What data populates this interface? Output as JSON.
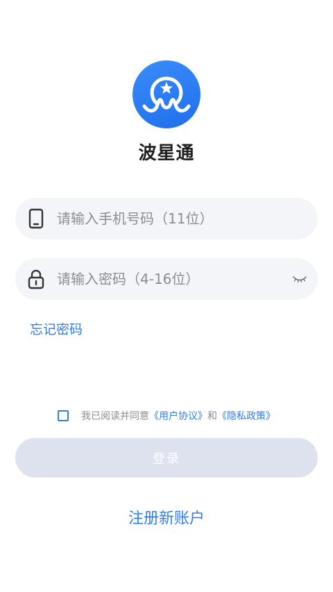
{
  "app": {
    "name": "波星通",
    "logo_icon": "octopus-star-logo-icon",
    "accent_color": "#2f7df2"
  },
  "phone_field": {
    "icon": "phone-icon",
    "placeholder": "请输入手机号码（11位）",
    "value": ""
  },
  "password_field": {
    "icon": "lock-icon",
    "placeholder": "请输入密码（4-16位）",
    "value": "",
    "toggle_icon": "eye-closed-icon"
  },
  "forgot_password_label": "忘记密码",
  "agreement": {
    "checked": false,
    "prefix": "我已阅读并同意",
    "user_agreement": "《用户协议》",
    "conjunction": "和",
    "privacy_policy": "《隐私政策》"
  },
  "login_button_label": "登录",
  "register_link_label": "注册新账户"
}
